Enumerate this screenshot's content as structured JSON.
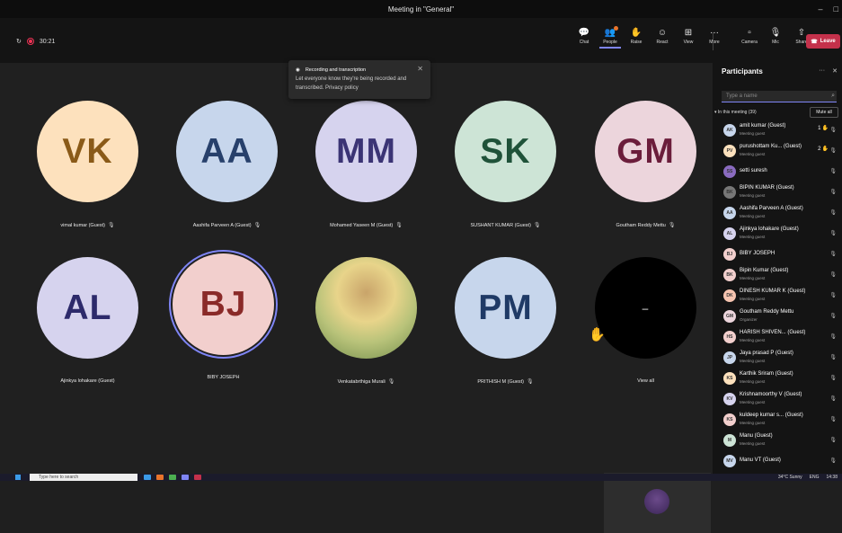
{
  "window": {
    "title": "Meeting in \"General\"",
    "minimize": "–",
    "maximize": "□"
  },
  "toolbar": {
    "timer": "30:21",
    "buttons": [
      {
        "label": "Chat",
        "icon": "chat-icon",
        "glyph": "💬"
      },
      {
        "label": "People",
        "icon": "people-icon",
        "glyph": "👥"
      },
      {
        "label": "Raise",
        "icon": "raise-hand-icon",
        "glyph": "✋"
      },
      {
        "label": "React",
        "icon": "react-icon",
        "glyph": "☺"
      },
      {
        "label": "View",
        "icon": "view-icon",
        "glyph": "⊞"
      },
      {
        "label": "More",
        "icon": "more-icon",
        "glyph": "···"
      },
      {
        "label": "Camera",
        "icon": "camera-off-icon",
        "glyph": "▫"
      },
      {
        "label": "Mic",
        "icon": "mic-off-icon",
        "glyph": "🎙"
      },
      {
        "label": "Share",
        "icon": "share-icon",
        "glyph": "⇧"
      }
    ],
    "leave_label": "Leave"
  },
  "popup": {
    "title": "Recording and transcription",
    "body": "Let everyone know they're being recorded and transcribed. Privacy policy"
  },
  "tiles": [
    {
      "initials": "VK",
      "name": "vimal kumar (Guest)",
      "bg": "#fde1bd",
      "fg": "#8a5a18",
      "muted": true
    },
    {
      "initials": "AA",
      "name": "Aashifa Parveen A (Guest)",
      "bg": "#c7d6ec",
      "fg": "#27406b",
      "muted": true
    },
    {
      "initials": "MM",
      "name": "Mohamed Yaseen M (Guest)",
      "bg": "#d6d3ee",
      "fg": "#3b3475",
      "muted": true
    },
    {
      "initials": "SK",
      "name": "SUSHANT KUMAR (Guest)",
      "bg": "#cde4d6",
      "fg": "#1f5239",
      "muted": true
    },
    {
      "initials": "GM",
      "name": "Goutham Reddy Mettu",
      "bg": "#ecd5dc",
      "fg": "#6b1d3b",
      "muted": true
    },
    {
      "initials": "AL",
      "name": "Ajinkya lohakare (Guest)",
      "bg": "#d6d3ee",
      "fg": "#2d2a6b",
      "muted": false
    },
    {
      "initials": "BJ",
      "name": "BIBY JOSEPH",
      "bg": "#f2cfcd",
      "fg": "#8a2a28",
      "muted": false
    },
    {
      "initials": "",
      "name": "Venkatabrthiga Murali",
      "bg": "#c8b870",
      "fg": "#333",
      "muted": true
    },
    {
      "initials": "PM",
      "name": "PRITHISH M (Guest)",
      "bg": "#c7d6ec",
      "fg": "#1f3a66",
      "muted": true
    },
    {
      "initials": "–",
      "name": "View all",
      "bg": "#000000",
      "fg": "#ffffff",
      "muted": false
    }
  ],
  "panel": {
    "title": "Participants",
    "search_placeholder": "Type a name",
    "section": "In this meeting (39)",
    "mute_all": "Mute all",
    "participants": [
      {
        "initials": "AK",
        "name": "amit kumar (Guest)",
        "role": "Meeting guest",
        "color": "#c7d6ec",
        "hand": "1"
      },
      {
        "initials": "PV",
        "name": "purushottam Ku... (Guest)",
        "role": "Meeting guest",
        "color": "#fde1bd",
        "hand": "2"
      },
      {
        "initials": "SS",
        "name": "setti suresh",
        "role": "",
        "color": "#8a6bc0",
        "hand": ""
      },
      {
        "initials": "BK",
        "name": "BIPIN KUMAR (Guest)",
        "role": "Meeting guest",
        "color": "#777777",
        "hand": ""
      },
      {
        "initials": "AA",
        "name": "Aashifa Parveen A (Guest)",
        "role": "Meeting guest",
        "color": "#c7d6ec",
        "hand": ""
      },
      {
        "initials": "AL",
        "name": "Ajinkya lohakare (Guest)",
        "role": "Meeting guest",
        "color": "#d6d3ee",
        "hand": ""
      },
      {
        "initials": "BJ",
        "name": "BIBY JOSEPH",
        "role": "",
        "color": "#f2cfcd",
        "hand": ""
      },
      {
        "initials": "BK",
        "name": "Bipin Kumar (Guest)",
        "role": "Meeting guest",
        "color": "#f2cfcd",
        "hand": ""
      },
      {
        "initials": "DK",
        "name": "DINESH KUMAR K (Guest)",
        "role": "Meeting guest",
        "color": "#f6c4b0",
        "hand": ""
      },
      {
        "initials": "GM",
        "name": "Goutham Reddy Mettu",
        "role": "Organizer",
        "color": "#ecd5dc",
        "hand": ""
      },
      {
        "initials": "HS",
        "name": "HARISH SHIVEN... (Guest)",
        "role": "Meeting guest",
        "color": "#f2cfcd",
        "hand": ""
      },
      {
        "initials": "JP",
        "name": "Jaya prasad P (Guest)",
        "role": "Meeting guest",
        "color": "#c7d6ec",
        "hand": ""
      },
      {
        "initials": "KS",
        "name": "Karthik Sriram (Guest)",
        "role": "Meeting guest",
        "color": "#fde1bd",
        "hand": ""
      },
      {
        "initials": "KV",
        "name": "Krishnamoorthy V (Guest)",
        "role": "Meeting guest",
        "color": "#d6d3ee",
        "hand": ""
      },
      {
        "initials": "KS",
        "name": "kuldeep kumar s... (Guest)",
        "role": "Meeting guest",
        "color": "#f2cfcd",
        "hand": ""
      },
      {
        "initials": "M",
        "name": "Manu (Guest)",
        "role": "Meeting guest",
        "color": "#cde4d6",
        "hand": ""
      },
      {
        "initials": "MV",
        "name": "Manu VT (Guest)",
        "role": "",
        "color": "#c7d6ec",
        "hand": ""
      }
    ]
  },
  "taskbar": {
    "search_placeholder": "Type here to search",
    "weather": "34°C Sunny",
    "lang": "ENG",
    "time": "14:38"
  }
}
